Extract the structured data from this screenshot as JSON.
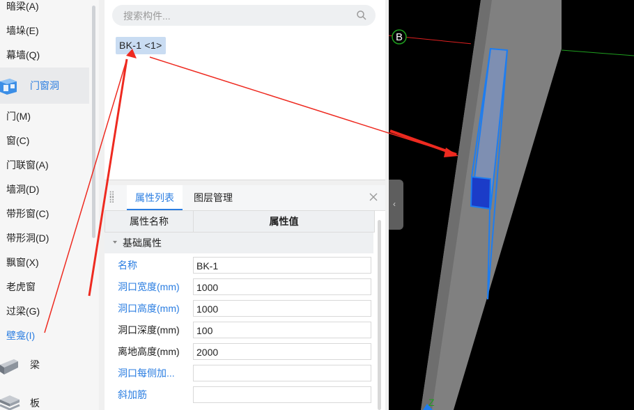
{
  "sidebar": {
    "items_top": [
      {
        "label": "暗梁(A)"
      },
      {
        "label": "墙垛(E)"
      },
      {
        "label": "幕墙(Q)"
      }
    ],
    "group_doors": {
      "label": "门窗洞",
      "icon": "door-window-opening-icon"
    },
    "items_doors": [
      {
        "label": "门(M)"
      },
      {
        "label": "窗(C)"
      },
      {
        "label": "门联窗(A)"
      },
      {
        "label": "墙洞(D)"
      },
      {
        "label": "带形窗(C)"
      },
      {
        "label": "带形洞(D)"
      },
      {
        "label": "飘窗(X)"
      },
      {
        "label": "老虎窗"
      },
      {
        "label": "过梁(G)"
      },
      {
        "label": "壁龛(I)"
      }
    ],
    "group_beam": {
      "label": "梁",
      "icon": "beam-icon"
    },
    "group_slab": {
      "label": "板",
      "icon": "slab-icon"
    }
  },
  "component_list": {
    "search_placeholder": "搜索构件...",
    "selected_component": "BK-1 <1>"
  },
  "properties": {
    "tabs": [
      "属性列表",
      "图层管理"
    ],
    "col_name": "属性名称",
    "col_value": "属性值",
    "group_label": "基础属性",
    "rows": [
      {
        "name": "名称",
        "value": "BK-1"
      },
      {
        "name": "洞口宽度(mm)",
        "value": "1000"
      },
      {
        "name": "洞口高度(mm)",
        "value": "1000"
      },
      {
        "name": "洞口深度(mm)",
        "value": "100"
      },
      {
        "name": "离地高度(mm)",
        "value": "2000"
      },
      {
        "name": "洞口每侧加...",
        "value": ""
      },
      {
        "name": "斜加筋",
        "value": ""
      }
    ]
  },
  "viewport": {
    "axis_label": "B",
    "z_label": "Z"
  },
  "colors": {
    "accent": "#2a7de1",
    "arrow": "#ee2a20",
    "wall": "#808080",
    "opening_outline": "#1e7df0"
  }
}
